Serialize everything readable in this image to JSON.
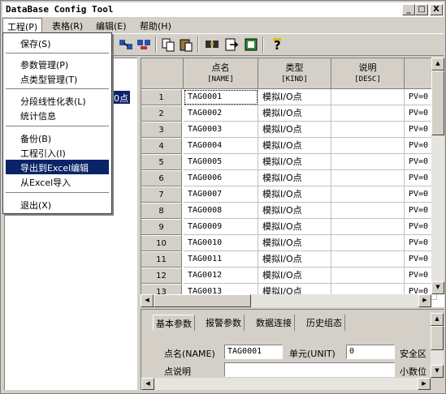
{
  "window": {
    "title": "DataBase Config Tool",
    "controls": {
      "minimize": "_",
      "maximize": "□",
      "close": "X"
    }
  },
  "menubar": {
    "items": [
      {
        "label": "工程(P)"
      },
      {
        "label": "表格(R)"
      },
      {
        "label": "编辑(E)"
      },
      {
        "label": "帮助(H)"
      }
    ]
  },
  "dropdown": {
    "items": [
      {
        "label": "保存(S)"
      },
      {
        "label": "参数管理(P)"
      },
      {
        "label": "点类型管理(T)"
      },
      {
        "label": "分段线性化表(L)"
      },
      {
        "label": "统计信息"
      },
      {
        "label": "备份(B)"
      },
      {
        "label": "工程引入(I)"
      },
      {
        "label": "导出到Excel编辑"
      },
      {
        "label": "从Excel导入"
      },
      {
        "label": "退出(X)"
      }
    ]
  },
  "toolbar": {
    "icons": [
      "link-icon",
      "unlink-icon",
      "copy-icon",
      "paste-icon",
      "find-icon",
      "export-icon",
      "import-icon",
      "help-icon"
    ]
  },
  "tree": {
    "selected_fragment": "0点"
  },
  "grid": {
    "headers": [
      {
        "title": "点名",
        "sub": "[NAME]"
      },
      {
        "title": "类型",
        "sub": "[KIND]"
      },
      {
        "title": "说明",
        "sub": "[DESC]"
      }
    ],
    "rows": [
      {
        "num": "1",
        "name": "TAG0001",
        "kind": "模拟I/O点",
        "desc": "",
        "extra": "PV=0"
      },
      {
        "num": "2",
        "name": "TAG0002",
        "kind": "模拟I/O点",
        "desc": "",
        "extra": "PV=0"
      },
      {
        "num": "3",
        "name": "TAG0003",
        "kind": "模拟I/O点",
        "desc": "",
        "extra": "PV=0"
      },
      {
        "num": "4",
        "name": "TAG0004",
        "kind": "模拟I/O点",
        "desc": "",
        "extra": "PV=0"
      },
      {
        "num": "5",
        "name": "TAG0005",
        "kind": "模拟I/O点",
        "desc": "",
        "extra": "PV=0"
      },
      {
        "num": "6",
        "name": "TAG0006",
        "kind": "模拟I/O点",
        "desc": "",
        "extra": "PV=0"
      },
      {
        "num": "7",
        "name": "TAG0007",
        "kind": "模拟I/O点",
        "desc": "",
        "extra": "PV=0"
      },
      {
        "num": "8",
        "name": "TAG0008",
        "kind": "模拟I/O点",
        "desc": "",
        "extra": "PV=0"
      },
      {
        "num": "9",
        "name": "TAG0009",
        "kind": "模拟I/O点",
        "desc": "",
        "extra": "PV=0"
      },
      {
        "num": "10",
        "name": "TAG0010",
        "kind": "模拟I/O点",
        "desc": "",
        "extra": "PV=0"
      },
      {
        "num": "11",
        "name": "TAG0011",
        "kind": "模拟I/O点",
        "desc": "",
        "extra": "PV=0"
      },
      {
        "num": "12",
        "name": "TAG0012",
        "kind": "模拟I/O点",
        "desc": "",
        "extra": "PV=0"
      },
      {
        "num": "13",
        "name": "TAG0013",
        "kind": "模拟I/O点",
        "desc": "",
        "extra": "PV=0"
      }
    ]
  },
  "bottom": {
    "tabs": [
      {
        "label": "基本参数"
      },
      {
        "label": "报警参数"
      },
      {
        "label": "数据连接"
      },
      {
        "label": "历史组态"
      }
    ],
    "fields": {
      "name_label": "点名(NAME)",
      "name_value": "TAG0001",
      "unit_label": "单元(UNIT)",
      "unit_value": "0",
      "safety_label": "安全区",
      "desc_label": "点说明",
      "desc_value": "",
      "decimals_label": "小数位"
    }
  }
}
